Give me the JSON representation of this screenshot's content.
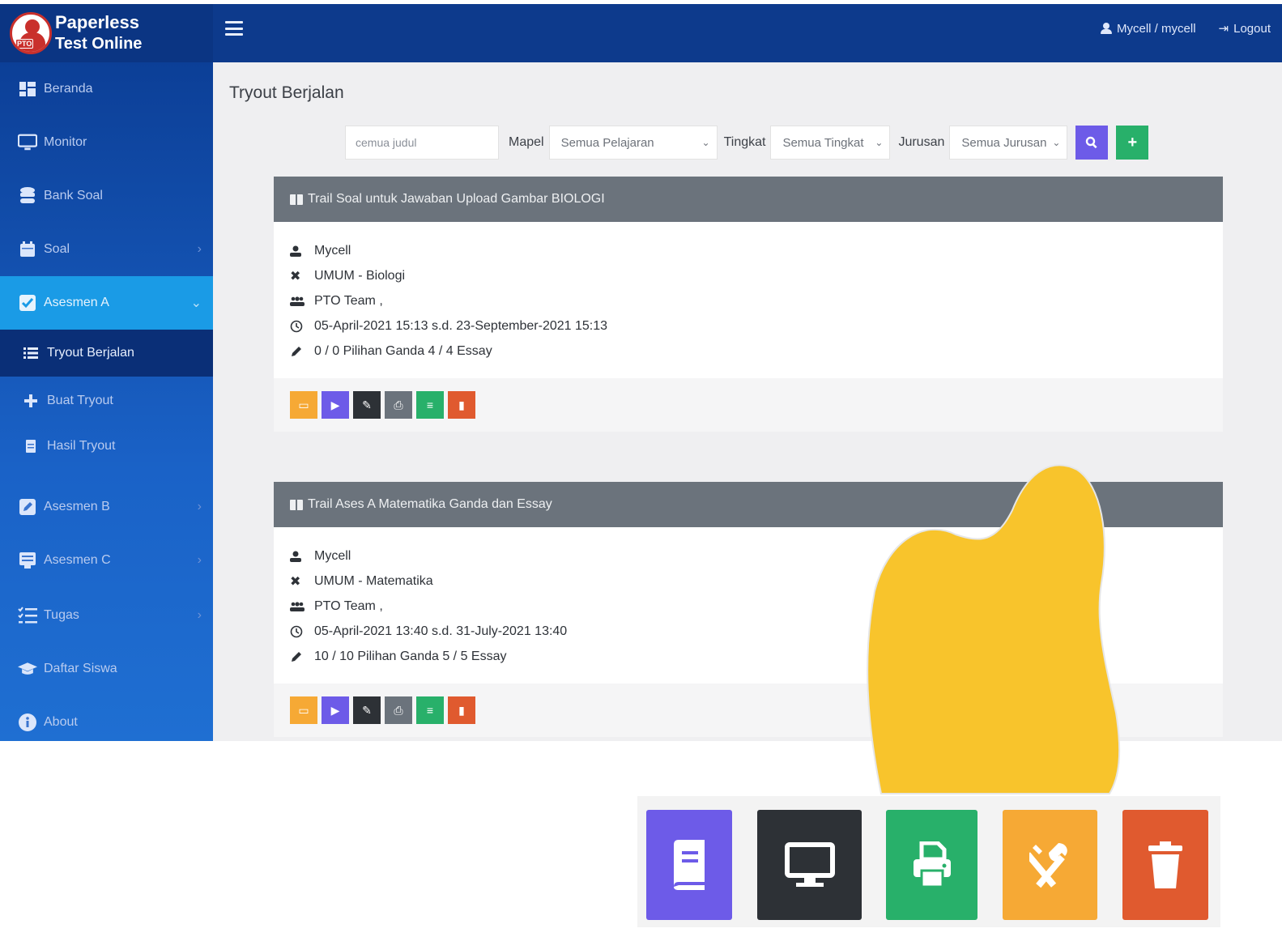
{
  "brand": {
    "line1": "Paperless",
    "line2": "Test Online",
    "logo_text": "PTO"
  },
  "topbar": {
    "user_label": "Mycell / mycell",
    "logout_label": "Logout"
  },
  "sidebar": {
    "items": [
      {
        "label": "Beranda",
        "icon": "dashboard-icon"
      },
      {
        "label": "Monitor",
        "icon": "monitor-icon"
      },
      {
        "label": "Bank Soal",
        "icon": "database-icon"
      },
      {
        "label": "Soal",
        "icon": "calendar-icon",
        "chevron": "›"
      },
      {
        "label": "Asesmen A",
        "icon": "checklist-icon",
        "chevron": "⌄"
      },
      {
        "label": "Tryout Berjalan",
        "icon": "list-icon"
      },
      {
        "label": "Buat Tryout",
        "icon": "plus-icon"
      },
      {
        "label": "Hasil Tryout",
        "icon": "file-icon"
      },
      {
        "label": "Asesmen B",
        "icon": "edit-icon",
        "chevron": "›"
      },
      {
        "label": "Asesmen C",
        "icon": "form-icon",
        "chevron": "›"
      },
      {
        "label": "Tugas",
        "icon": "tasks-icon",
        "chevron": "›"
      },
      {
        "label": "Daftar Siswa",
        "icon": "graduation-cap-icon"
      },
      {
        "label": "About",
        "icon": "info-icon"
      }
    ]
  },
  "main": {
    "title": "Tryout Berjalan",
    "filters": {
      "search_placeholder": "cemua judul",
      "mapel_label": "Mapel",
      "mapel_value": "Semua Pelajaran",
      "tingkat_label": "Tingkat",
      "tingkat_value": "Semua Tingkat",
      "jurusan_label": "Jurusan",
      "jurusan_value": "Semua Jurusan",
      "search_button": "🔍",
      "add_button": "+"
    },
    "cards": [
      {
        "title": "Trail Soal untuk Jawaban Upload Gambar BIOLOGI",
        "author": "Mycell",
        "subject": "UMUM - Biologi",
        "team": "PTO Team ,",
        "schedule": "05-April-2021 15:13  s.d.  23-September-2021 15:13",
        "counts": "0 / 0 Pilihan Ganda   4 / 4 Essay"
      },
      {
        "title": "Trail Ases A Matematika Ganda dan Essay",
        "author": "Mycell",
        "subject": "UMUM - Matematika",
        "team": "PTO Team ,",
        "schedule": "05-April-2021 13:40  s.d.  31-July-2021 13:40",
        "counts": "10 / 10 Pilihan Ganda   5 / 5 Essay"
      }
    ]
  },
  "colors": {
    "topbar": "#0d3a8c",
    "sidebar_active": "#1a9be6",
    "card_header": "#6b737c",
    "orange": "#f6a935",
    "purple": "#6d5be8",
    "dark": "#2d3136",
    "gray": "#6b737c",
    "green": "#28b06a",
    "red": "#e05a2f",
    "yellow_blob": "#f8c42c"
  }
}
